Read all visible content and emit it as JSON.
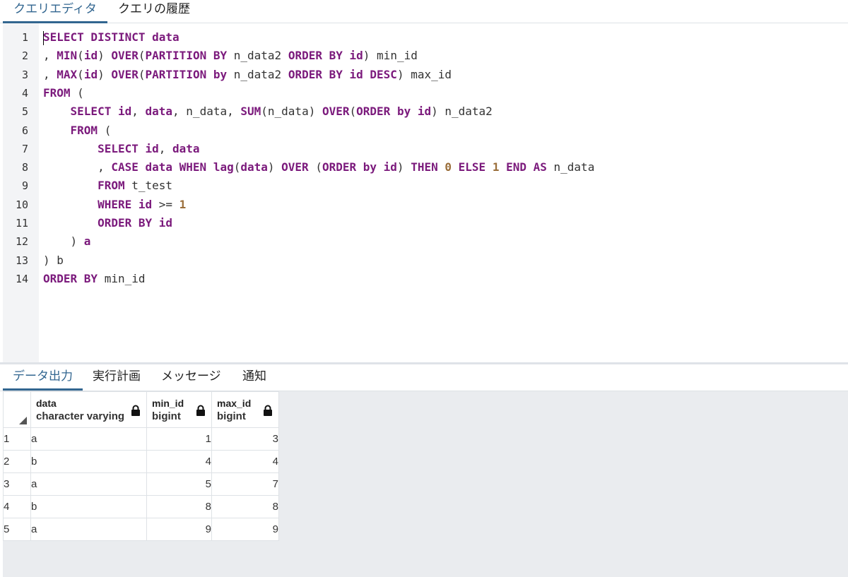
{
  "top_tabs": [
    {
      "label": "クエリエディタ",
      "active": true
    },
    {
      "label": "クエリの履歴",
      "active": false
    }
  ],
  "editor": {
    "line_numbers": [
      "1",
      "2",
      "3",
      "4",
      "5",
      "6",
      "7",
      "8",
      "9",
      "10",
      "11",
      "12",
      "13",
      "14"
    ],
    "lines": [
      [
        {
          "t": "SELECT DISTINCT data",
          "c": "kw"
        }
      ],
      [
        {
          "t": ", ",
          "c": "pl"
        },
        {
          "t": "MIN",
          "c": "kw"
        },
        {
          "t": "(",
          "c": "pl"
        },
        {
          "t": "id",
          "c": "kw"
        },
        {
          "t": ") ",
          "c": "pl"
        },
        {
          "t": "OVER",
          "c": "kw"
        },
        {
          "t": "(",
          "c": "pl"
        },
        {
          "t": "PARTITION BY",
          "c": "kw"
        },
        {
          "t": " n_data2 ",
          "c": "pl"
        },
        {
          "t": "ORDER BY id",
          "c": "kw"
        },
        {
          "t": ") min_id",
          "c": "pl"
        }
      ],
      [
        {
          "t": ", ",
          "c": "pl"
        },
        {
          "t": "MAX",
          "c": "kw"
        },
        {
          "t": "(",
          "c": "pl"
        },
        {
          "t": "id",
          "c": "kw"
        },
        {
          "t": ") ",
          "c": "pl"
        },
        {
          "t": "OVER",
          "c": "kw"
        },
        {
          "t": "(",
          "c": "pl"
        },
        {
          "t": "PARTITION by",
          "c": "kw"
        },
        {
          "t": " n_data2 ",
          "c": "pl"
        },
        {
          "t": "ORDER BY id DESC",
          "c": "kw"
        },
        {
          "t": ") max_id",
          "c": "pl"
        }
      ],
      [
        {
          "t": "FROM",
          "c": "kw"
        },
        {
          "t": " (",
          "c": "pl"
        }
      ],
      [
        {
          "t": "    ",
          "c": "pl"
        },
        {
          "t": "SELECT id",
          "c": "kw"
        },
        {
          "t": ", ",
          "c": "pl"
        },
        {
          "t": "data",
          "c": "kw"
        },
        {
          "t": ", n_data, ",
          "c": "pl"
        },
        {
          "t": "SUM",
          "c": "kw"
        },
        {
          "t": "(n_data) ",
          "c": "pl"
        },
        {
          "t": "OVER",
          "c": "kw"
        },
        {
          "t": "(",
          "c": "pl"
        },
        {
          "t": "ORDER by id",
          "c": "kw"
        },
        {
          "t": ") n_data2",
          "c": "pl"
        }
      ],
      [
        {
          "t": "    ",
          "c": "pl"
        },
        {
          "t": "FROM",
          "c": "kw"
        },
        {
          "t": " (",
          "c": "pl"
        }
      ],
      [
        {
          "t": "        ",
          "c": "pl"
        },
        {
          "t": "SELECT id",
          "c": "kw"
        },
        {
          "t": ", ",
          "c": "pl"
        },
        {
          "t": "data",
          "c": "kw"
        }
      ],
      [
        {
          "t": "        , ",
          "c": "pl"
        },
        {
          "t": "CASE data WHEN lag",
          "c": "kw"
        },
        {
          "t": "(",
          "c": "pl"
        },
        {
          "t": "data",
          "c": "kw"
        },
        {
          "t": ") ",
          "c": "pl"
        },
        {
          "t": "OVER",
          "c": "kw"
        },
        {
          "t": " (",
          "c": "pl"
        },
        {
          "t": "ORDER by id",
          "c": "kw"
        },
        {
          "t": ") ",
          "c": "pl"
        },
        {
          "t": "THEN",
          "c": "kw"
        },
        {
          "t": " ",
          "c": "pl"
        },
        {
          "t": "0",
          "c": "nm"
        },
        {
          "t": " ",
          "c": "pl"
        },
        {
          "t": "ELSE",
          "c": "kw"
        },
        {
          "t": " ",
          "c": "pl"
        },
        {
          "t": "1",
          "c": "nm"
        },
        {
          "t": " ",
          "c": "pl"
        },
        {
          "t": "END AS",
          "c": "kw"
        },
        {
          "t": " n_data",
          "c": "pl"
        }
      ],
      [
        {
          "t": "        ",
          "c": "pl"
        },
        {
          "t": "FROM",
          "c": "kw"
        },
        {
          "t": " t_test",
          "c": "pl"
        }
      ],
      [
        {
          "t": "        ",
          "c": "pl"
        },
        {
          "t": "WHERE id",
          "c": "kw"
        },
        {
          "t": " >= ",
          "c": "pl"
        },
        {
          "t": "1",
          "c": "nm"
        }
      ],
      [
        {
          "t": "        ",
          "c": "pl"
        },
        {
          "t": "ORDER BY id",
          "c": "kw"
        }
      ],
      [
        {
          "t": "    ) ",
          "c": "pl"
        },
        {
          "t": "a",
          "c": "kw"
        }
      ],
      [
        {
          "t": ") b",
          "c": "pl"
        }
      ],
      [
        {
          "t": "ORDER BY",
          "c": "kw"
        },
        {
          "t": " min_id",
          "c": "pl"
        }
      ]
    ]
  },
  "bottom_tabs": [
    {
      "label": "データ出力",
      "active": true
    },
    {
      "label": "実行計画",
      "active": false
    },
    {
      "label": "メッセージ",
      "active": false
    },
    {
      "label": "通知",
      "active": false
    }
  ],
  "grid": {
    "columns": [
      {
        "name": "data",
        "type": "character varying"
      },
      {
        "name": "min_id",
        "type": "bigint"
      },
      {
        "name": "max_id",
        "type": "bigint"
      }
    ],
    "rows": [
      {
        "n": "1",
        "data": "a",
        "min_id": "1",
        "max_id": "3"
      },
      {
        "n": "2",
        "data": "b",
        "min_id": "4",
        "max_id": "4"
      },
      {
        "n": "3",
        "data": "a",
        "min_id": "5",
        "max_id": "7"
      },
      {
        "n": "4",
        "data": "b",
        "min_id": "8",
        "max_id": "8"
      },
      {
        "n": "5",
        "data": "a",
        "min_id": "9",
        "max_id": "9"
      }
    ]
  },
  "colors": {
    "accent": "#326690",
    "keyword": "#7b1a7c",
    "number": "#9a6e3a"
  }
}
